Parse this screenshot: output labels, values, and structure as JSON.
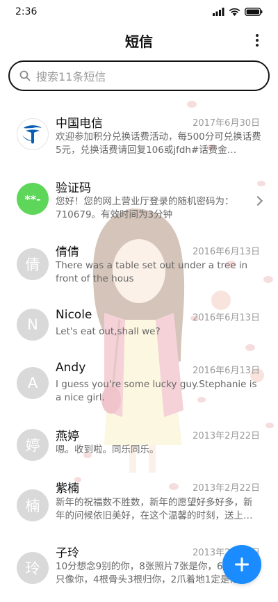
{
  "status": {
    "time": "2:36"
  },
  "header": {
    "title": "短信"
  },
  "search": {
    "placeholder": "搜索11条短信"
  },
  "messages": [
    {
      "name": "中国电信",
      "date": "2017年6月30日",
      "preview": "欢迎参加积分兑换话费活动，每500分可兑换话费5元，兑换话费请回复106或jfdh#话费金…",
      "avatar": "telecom-logo"
    },
    {
      "name": "验证码",
      "date": "",
      "preview": "您好！您的网上营业厅登录的随机密码为：710679。有效时间为3分钟",
      "avatar_text": "**-"
    },
    {
      "name": "倩倩",
      "date": "2016年6月13日",
      "preview": "There was a table set out under a tree in front of the hous",
      "avatar_text": "倩"
    },
    {
      "name": "Nicole",
      "date": "2016年6月13日",
      "preview": "Let's eat out,shall we?",
      "avatar_text": "N"
    },
    {
      "name": "Andy",
      "date": "2016年6月13日",
      "preview": "I guess you're some lucky guy.Stephanie is a nice girl.",
      "avatar_text": "A"
    },
    {
      "name": "燕婷",
      "date": "2013年2月22日",
      "preview": "嗯。收到啦。同乐同乐。",
      "avatar_text": "婷"
    },
    {
      "name": "紫楠",
      "date": "2013年2月22日",
      "preview": "新年的祝福数不胜数，新年的愿望好多好多，新年的问候依旧美好，在这个温馨的时刻，送上…",
      "avatar_text": "楠"
    },
    {
      "name": "子玲",
      "date": "2013年2月22日",
      "preview": "10分想念9别的你，8张照片7张是你，6片回忆5只像你，4根骨头3根归你，2爪着地1定是你，",
      "avatar_text": "玲"
    }
  ],
  "colors": {
    "accent": "#1a8cff",
    "verify_avatar": "#5dd65a",
    "telecom_blue": "#0a5fb4"
  }
}
